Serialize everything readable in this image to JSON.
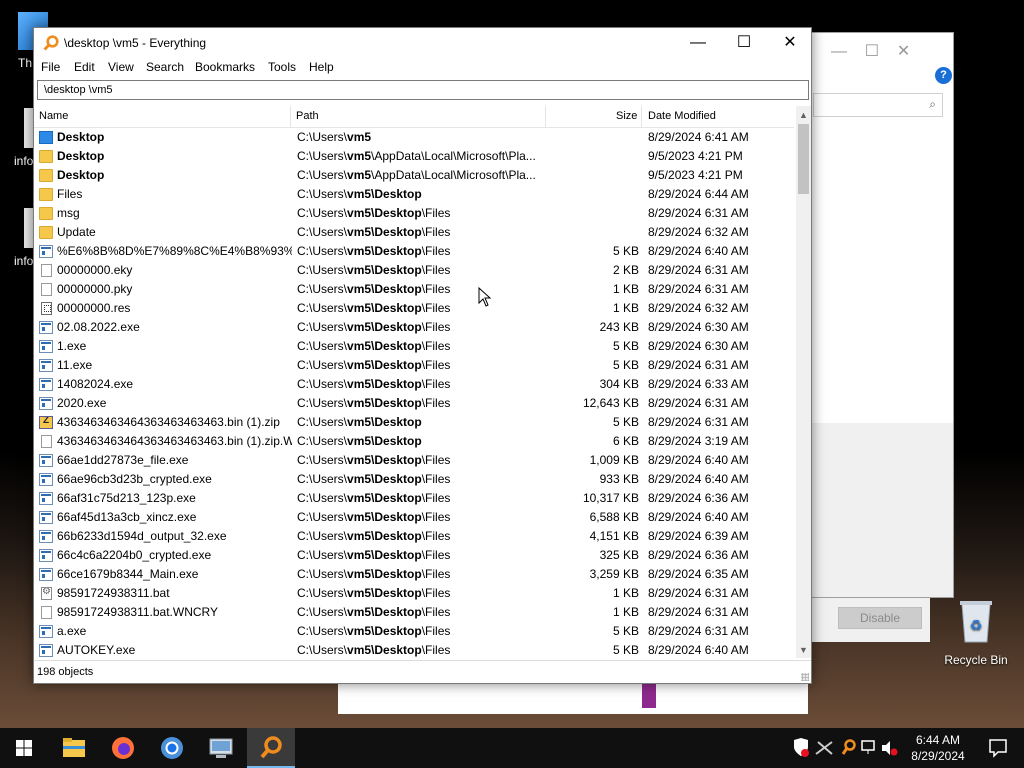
{
  "window": {
    "title": "\\desktop \\vm5 - Everything",
    "controls": {
      "minimize": "—",
      "maximize": "☐",
      "close": "✕"
    }
  },
  "menu": [
    "File",
    "Edit",
    "View",
    "Search",
    "Bookmarks",
    "Tools",
    "Help"
  ],
  "search": {
    "value": "\\desktop \\vm5"
  },
  "columns": {
    "name": "Name",
    "path": "Path",
    "size": "Size",
    "date": "Date Modified"
  },
  "rows": [
    {
      "icon": "folder-blue-icon",
      "name": "Desktop",
      "name_bold": true,
      "path_pre": "C:\\Users\\",
      "path_bold": "vm5",
      "path_post": "",
      "size": "",
      "date": "8/29/2024 6:41 AM"
    },
    {
      "icon": "folder-icon",
      "name": "Desktop",
      "name_bold": true,
      "path_pre": "C:\\Users\\",
      "path_bold": "vm5",
      "path_post": "\\AppData\\Local\\Microsoft\\Pla...",
      "size": "",
      "date": "9/5/2023 4:21 PM"
    },
    {
      "icon": "folder-icon",
      "name": "Desktop",
      "name_bold": true,
      "path_pre": "C:\\Users\\",
      "path_bold": "vm5",
      "path_post": "\\AppData\\Local\\Microsoft\\Pla...",
      "size": "",
      "date": "9/5/2023 4:21 PM"
    },
    {
      "icon": "folder-icon",
      "name": "Files",
      "name_bold": false,
      "path_pre": "C:\\Users\\",
      "path_bold": "vm5\\Desktop",
      "path_post": "",
      "size": "",
      "date": "8/29/2024 6:44 AM"
    },
    {
      "icon": "folder-icon",
      "name": "msg",
      "name_bold": false,
      "path_pre": "C:\\Users\\",
      "path_bold": "vm5\\Desktop",
      "path_post": "\\Files",
      "size": "",
      "date": "8/29/2024 6:31 AM"
    },
    {
      "icon": "folder-icon",
      "name": "Update",
      "name_bold": false,
      "path_pre": "C:\\Users\\",
      "path_bold": "vm5\\Desktop",
      "path_post": "\\Files",
      "size": "",
      "date": "8/29/2024 6:32 AM"
    },
    {
      "icon": "exe-icon",
      "name": "%E6%8B%8D%E7%89%8C%E4%B8%93%E...",
      "name_bold": false,
      "path_pre": "C:\\Users\\",
      "path_bold": "vm5\\Desktop",
      "path_post": "\\Files",
      "size": "5 KB",
      "date": "8/29/2024 6:40 AM"
    },
    {
      "icon": "file-icon",
      "name": "00000000.eky",
      "name_bold": false,
      "path_pre": "C:\\Users\\",
      "path_bold": "vm5\\Desktop",
      "path_post": "\\Files",
      "size": "2 KB",
      "date": "8/29/2024 6:31 AM"
    },
    {
      "icon": "file-icon",
      "name": "00000000.pky",
      "name_bold": false,
      "path_pre": "C:\\Users\\",
      "path_bold": "vm5\\Desktop",
      "path_post": "\\Files",
      "size": "1 KB",
      "date": "8/29/2024 6:31 AM"
    },
    {
      "icon": "res-icon",
      "name": "00000000.res",
      "name_bold": false,
      "path_pre": "C:\\Users\\",
      "path_bold": "vm5\\Desktop",
      "path_post": "\\Files",
      "size": "1 KB",
      "date": "8/29/2024 6:32 AM"
    },
    {
      "icon": "exe-icon",
      "name": "02.08.2022.exe",
      "name_bold": false,
      "path_pre": "C:\\Users\\",
      "path_bold": "vm5\\Desktop",
      "path_post": "\\Files",
      "size": "243 KB",
      "date": "8/29/2024 6:30 AM"
    },
    {
      "icon": "exe-icon",
      "name": "1.exe",
      "name_bold": false,
      "path_pre": "C:\\Users\\",
      "path_bold": "vm5\\Desktop",
      "path_post": "\\Files",
      "size": "5 KB",
      "date": "8/29/2024 6:30 AM"
    },
    {
      "icon": "exe-icon",
      "name": "11.exe",
      "name_bold": false,
      "path_pre": "C:\\Users\\",
      "path_bold": "vm5\\Desktop",
      "path_post": "\\Files",
      "size": "5 KB",
      "date": "8/29/2024 6:31 AM"
    },
    {
      "icon": "exe-icon",
      "name": "14082024.exe",
      "name_bold": false,
      "path_pre": "C:\\Users\\",
      "path_bold": "vm5\\Desktop",
      "path_post": "\\Files",
      "size": "304 KB",
      "date": "8/29/2024 6:33 AM"
    },
    {
      "icon": "exe-icon",
      "name": "2020.exe",
      "name_bold": false,
      "path_pre": "C:\\Users\\",
      "path_bold": "vm5\\Desktop",
      "path_post": "\\Files",
      "size": "12,643 KB",
      "date": "8/29/2024 6:31 AM"
    },
    {
      "icon": "zip-icon",
      "name": "4363463463464363463463463.bin (1).zip",
      "name_bold": false,
      "path_pre": "C:\\Users\\",
      "path_bold": "vm5\\Desktop",
      "path_post": "",
      "size": "5 KB",
      "date": "8/29/2024 6:31 AM"
    },
    {
      "icon": "file-icon",
      "name": "4363463463464363463463463.bin (1).zip.W...",
      "name_bold": false,
      "path_pre": "C:\\Users\\",
      "path_bold": "vm5\\Desktop",
      "path_post": "",
      "size": "6 KB",
      "date": "8/29/2024 3:19 AM"
    },
    {
      "icon": "exe-icon",
      "name": "66ae1dd27873e_file.exe",
      "name_bold": false,
      "path_pre": "C:\\Users\\",
      "path_bold": "vm5\\Desktop",
      "path_post": "\\Files",
      "size": "1,009 KB",
      "date": "8/29/2024 6:40 AM"
    },
    {
      "icon": "exe-icon",
      "name": "66ae96cb3d23b_crypted.exe",
      "name_bold": false,
      "path_pre": "C:\\Users\\",
      "path_bold": "vm5\\Desktop",
      "path_post": "\\Files",
      "size": "933 KB",
      "date": "8/29/2024 6:40 AM"
    },
    {
      "icon": "exe-icon",
      "name": "66af31c75d213_123p.exe",
      "name_bold": false,
      "path_pre": "C:\\Users\\",
      "path_bold": "vm5\\Desktop",
      "path_post": "\\Files",
      "size": "10,317 KB",
      "date": "8/29/2024 6:36 AM"
    },
    {
      "icon": "exe-icon",
      "name": "66af45d13a3cb_xincz.exe",
      "name_bold": false,
      "path_pre": "C:\\Users\\",
      "path_bold": "vm5\\Desktop",
      "path_post": "\\Files",
      "size": "6,588 KB",
      "date": "8/29/2024 6:40 AM"
    },
    {
      "icon": "exe-icon",
      "name": "66b6233d1594d_output_32.exe",
      "name_bold": false,
      "path_pre": "C:\\Users\\",
      "path_bold": "vm5\\Desktop",
      "path_post": "\\Files",
      "size": "4,151 KB",
      "date": "8/29/2024 6:39 AM"
    },
    {
      "icon": "exe-icon",
      "name": "66c4c6a2204b0_crypted.exe",
      "name_bold": false,
      "path_pre": "C:\\Users\\",
      "path_bold": "vm5\\Desktop",
      "path_post": "\\Files",
      "size": "325 KB",
      "date": "8/29/2024 6:36 AM"
    },
    {
      "icon": "exe-icon",
      "name": "66ce1679b8344_Main.exe",
      "name_bold": false,
      "path_pre": "C:\\Users\\",
      "path_bold": "vm5\\Desktop",
      "path_post": "\\Files",
      "size": "3,259 KB",
      "date": "8/29/2024 6:35 AM"
    },
    {
      "icon": "bat-icon",
      "name": "98591724938311.bat",
      "name_bold": false,
      "path_pre": "C:\\Users\\",
      "path_bold": "vm5\\Desktop",
      "path_post": "\\Files",
      "size": "1 KB",
      "date": "8/29/2024 6:31 AM"
    },
    {
      "icon": "file-icon",
      "name": "98591724938311.bat.WNCRY",
      "name_bold": false,
      "path_pre": "C:\\Users\\",
      "path_bold": "vm5\\Desktop",
      "path_post": "\\Files",
      "size": "1 KB",
      "date": "8/29/2024 6:31 AM"
    },
    {
      "icon": "exe-icon",
      "name": "a.exe",
      "name_bold": false,
      "path_pre": "C:\\Users\\",
      "path_bold": "vm5\\Desktop",
      "path_post": "\\Files",
      "size": "5 KB",
      "date": "8/29/2024 6:31 AM"
    },
    {
      "icon": "exe-icon",
      "name": "AUTOKEY.exe",
      "name_bold": false,
      "path_pre": "C:\\Users\\",
      "path_bold": "vm5\\Desktop",
      "path_post": "\\Files",
      "size": "5 KB",
      "date": "8/29/2024 6:40 AM"
    }
  ],
  "status": "198 objects",
  "background": {
    "disable_label": "Disable",
    "desktop_icons": [
      "Th",
      "info",
      "info"
    ],
    "recycle_bin": "Recycle Bin"
  },
  "taskbar": {
    "apps": [
      "file-explorer-icon",
      "firefox-icon",
      "chrome-icon",
      "network-app-icon",
      "everything-icon"
    ],
    "time": "6:44 AM",
    "date": "8/29/2024"
  },
  "colors": {
    "accent": "#76b9ed",
    "folder": "#f5c74a",
    "everything_orange": "#f08c1e"
  }
}
